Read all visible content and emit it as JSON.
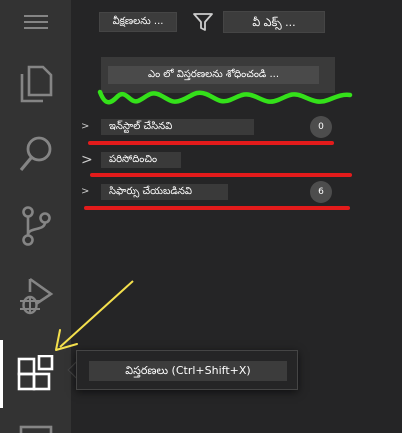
{
  "header": {
    "views_label": "వీక్షణలను ...",
    "filter_icon": "filter-icon",
    "more_label": "వీ ఎక్స్ ..."
  },
  "search": {
    "placeholder": "ఎం లో విస్తరణలను శోధించండి ..."
  },
  "sections": [
    {
      "chevron": ">",
      "title": "ఇన్‌స్టాల్ చేసినవి",
      "count": "0"
    },
    {
      "chevron": ">",
      "title": "సిఫార్సు చేయబడినవి",
      "count": "6"
    }
  ],
  "recommended_section": {
    "chevron": ">",
    "title": "పరిసోదించిం"
  },
  "tooltip": {
    "text": "విస్తరణలు (Ctrl+Shift+X)"
  },
  "activity_bar": {
    "items": [
      "menu-icon",
      "files-icon",
      "search-icon",
      "source-control-icon",
      "run-debug-icon",
      "extensions-icon",
      "panel-icon"
    ]
  },
  "colors": {
    "activity_bar_bg": "#333333",
    "side_bar_bg": "#252526",
    "annotation_green": "#34e11a",
    "annotation_red": "#e31b1b",
    "annotation_yellow": "#f4e04d"
  }
}
